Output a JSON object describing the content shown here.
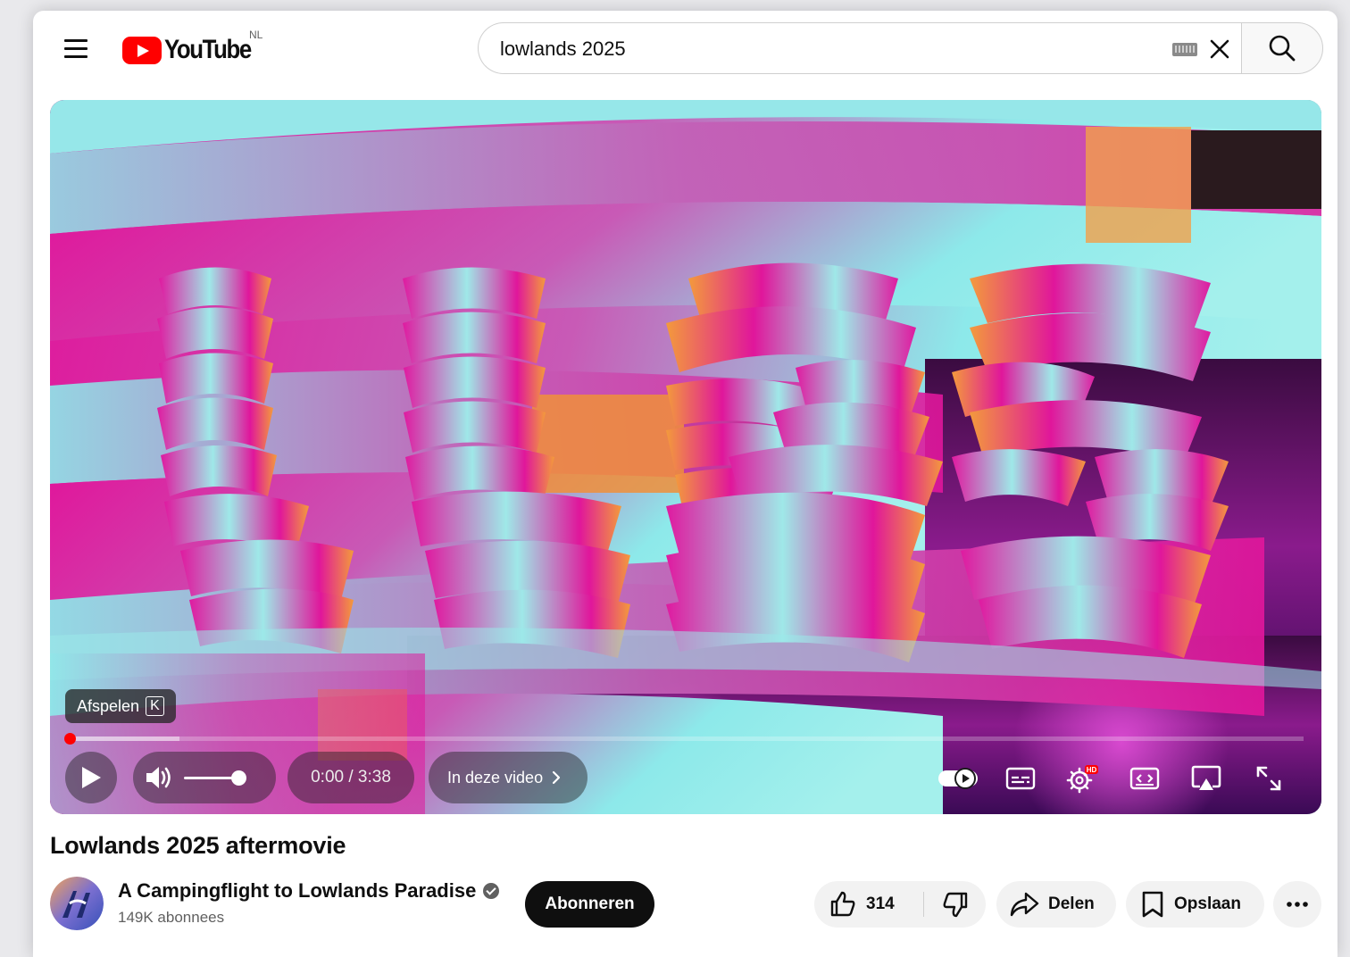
{
  "masthead": {
    "logo_text": "YouTube",
    "country_code": "NL",
    "search_value": "lowlands 2025",
    "icons": [
      "menu-icon",
      "keyboard-icon",
      "clear-icon",
      "search-icon"
    ]
  },
  "player": {
    "tooltip_label": "Afspelen",
    "tooltip_key": "K",
    "time": "0:00 / 3:38",
    "chapter_label": "In deze video",
    "progress": 0.0,
    "volume": 1.0,
    "icons": [
      "play-icon",
      "volume-icon",
      "chevron-right-icon",
      "autoplay-toggle-icon",
      "subtitles-icon",
      "settings-icon",
      "miniplayer-icon",
      "cast-icon",
      "fullscreen-icon"
    ],
    "settings_badge": "HD"
  },
  "video": {
    "title": "Lowlands 2025 aftermovie"
  },
  "channel": {
    "name": "A Campingflight to Lowlands Paradise",
    "subscribers": "149K abonnees",
    "subscribe_label": "Abonneren"
  },
  "actions": {
    "like_count": "314",
    "share_label": "Delen",
    "save_label": "Opslaan"
  },
  "colors": {
    "brand_red": "#ff0000",
    "frame_magenta": "#e0169b",
    "frame_cyan": "#8de9ea",
    "frame_orange": "#f2923a"
  }
}
